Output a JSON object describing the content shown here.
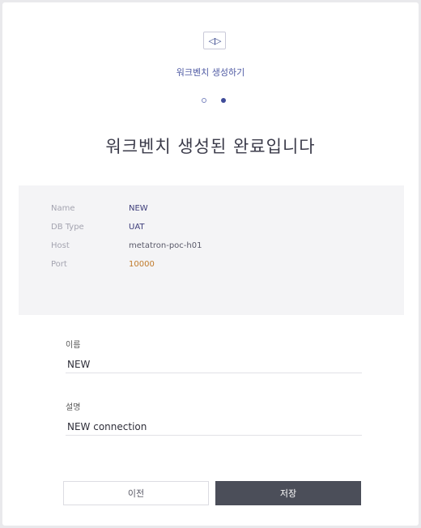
{
  "wizard": {
    "logo_glyph": "◁▷",
    "title": "워크벤치 생성하기",
    "steps": [
      "1",
      "2"
    ],
    "current_step": 2,
    "heading": "워크벤치 생성된 완료입니다"
  },
  "connection_info": {
    "rows": [
      {
        "key": "Name",
        "value": "NEW"
      },
      {
        "key": "DB Type",
        "value": "UAT"
      },
      {
        "key": "Host",
        "value": "metatron-poc-h01"
      },
      {
        "key": "Port",
        "value": "10000"
      }
    ]
  },
  "form": {
    "name_label": "이름",
    "name_value": "NEW",
    "desc_label": "설명",
    "desc_value": "NEW connection"
  },
  "buttons": {
    "prev_label": "이전",
    "save_label": "저장"
  },
  "colors": {
    "accent": "#3f4b99",
    "primary_button": "#4b4e59",
    "info_background": "#f4f4f6"
  }
}
